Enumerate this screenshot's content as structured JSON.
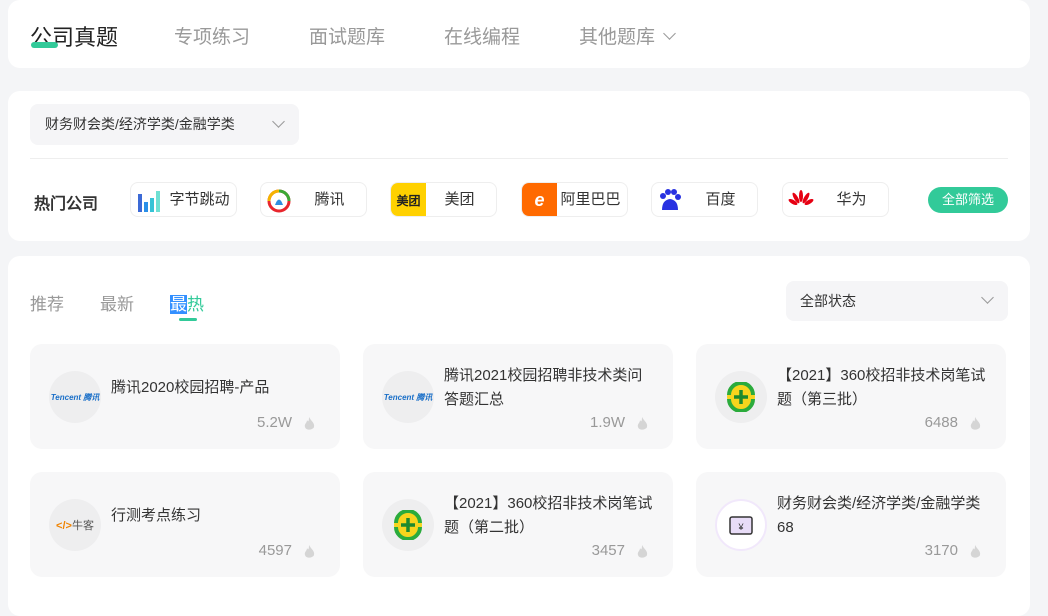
{
  "nav": {
    "items": [
      "公司真题",
      "专项练习",
      "面试题库",
      "在线编程",
      "其他题库"
    ],
    "active": 0
  },
  "filter": {
    "category": "财务财会类/经济学类/金融学类",
    "hot_label": "热门公司",
    "all_filter": "全部筛选",
    "companies": [
      {
        "name": "字节跳动",
        "logo": "bytedance-logo"
      },
      {
        "name": "腾讯",
        "logo": "tencent-logo"
      },
      {
        "name": "美团",
        "logo": "meituan-logo",
        "logo_text": "美团"
      },
      {
        "name": "阿里巴巴",
        "logo": "alibaba-logo"
      },
      {
        "name": "百度",
        "logo": "baidu-logo"
      },
      {
        "name": "华为",
        "logo": "huawei-logo"
      }
    ]
  },
  "content": {
    "tabs": [
      "推荐",
      "最新",
      "最热"
    ],
    "active_tab": 2,
    "status": "全部状态",
    "cards": [
      {
        "title": "腾讯2020校园招聘-产品",
        "count": "5.2W",
        "logo": "tencent-logo",
        "logo_text": "Tencent 腾讯"
      },
      {
        "title": "腾讯2021校园招聘非技术类问答题汇总",
        "count": "1.9W",
        "logo": "tencent-logo",
        "logo_text": "Tencent 腾讯"
      },
      {
        "title": "【2021】360校招非技术岗笔试题（第三批）",
        "count": "6488",
        "logo": "360-logo"
      },
      {
        "title": "行测考点练习",
        "count": "4597",
        "logo": "nowcoder-logo",
        "logo_text": "牛客"
      },
      {
        "title": "【2021】360校招非技术岗笔试题（第二批）",
        "count": "3457",
        "logo": "360-logo"
      },
      {
        "title": "财务财会类/经济学类/金融学类68",
        "count": "3170",
        "logo": "finance-logo"
      }
    ]
  },
  "colors": {
    "accent": "#32ca99"
  }
}
